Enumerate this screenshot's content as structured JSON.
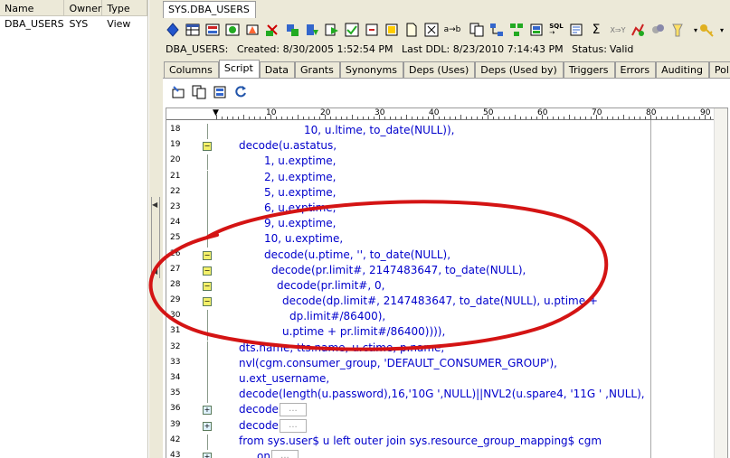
{
  "object_list": {
    "columns": [
      "Name",
      "Owner",
      "Type"
    ],
    "rows": [
      {
        "name": "DBA_USERS",
        "owner": "SYS",
        "type": "View"
      }
    ]
  },
  "document_tab": "SYS.DBA_USERS",
  "status": {
    "object": "DBA_USERS:",
    "created_label": "Created: 8/30/2005 1:52:54 PM",
    "last_ddl_label": "Last DDL: 8/23/2010 7:14:43 PM",
    "status_label": "Status:",
    "status_value": "Valid"
  },
  "tabs": [
    "Columns",
    "Script",
    "Data",
    "Grants",
    "Synonyms",
    "Deps (Uses)",
    "Deps (Used by)",
    "Triggers",
    "Errors",
    "Auditing",
    "Policies"
  ],
  "active_tab": "Script",
  "toolbar_icons": [
    "filter-icon",
    "table-icon",
    "index-icon",
    "constraint-icon",
    "trigger-icon",
    "delete-icon",
    "drop-icon",
    "user-icon",
    "grant-icon",
    "compile-icon",
    "export-icon",
    "import-icon",
    "doc-icon",
    "rename-icon",
    "search-replace-icon",
    "ab-icon",
    "copy-icon",
    "hierarchy-icon",
    "structure-icon",
    "tree-icon",
    "sql-icon",
    "sql-plan-icon",
    "sum-icon",
    "xy-icon",
    "chart-icon",
    "query-icon",
    "flashlight-icon",
    "key-icon",
    "dropdown-icon",
    "arrow-down-icon"
  ],
  "script_toolbar_icons": [
    "edit-script-icon",
    "copy-script-icon",
    "save-script-icon",
    "refresh-script-icon"
  ],
  "ruler": {
    "labels": [
      "10",
      "20",
      "30",
      "40",
      "50",
      "60",
      "70",
      "80",
      "90"
    ]
  },
  "code_lines": [
    {
      "num": "18",
      "fold": "",
      "text": "10, u.ltime, to_date(NULL)),"
    },
    {
      "num": "19",
      "fold": "-",
      "text": "decode(u.astatus,"
    },
    {
      "num": "20",
      "fold": "",
      "text": "1, u.exptime,"
    },
    {
      "num": "21",
      "fold": "",
      "text": "2, u.exptime,"
    },
    {
      "num": "22",
      "fold": "",
      "text": "5, u.exptime,"
    },
    {
      "num": "23",
      "fold": "",
      "text": "6, u.exptime,"
    },
    {
      "num": "24",
      "fold": "",
      "text": "9, u.exptime,"
    },
    {
      "num": "25",
      "fold": "",
      "text": "10, u.exptime,"
    },
    {
      "num": "26",
      "fold": "-",
      "text": "decode(u.ptime, '', to_date(NULL),"
    },
    {
      "num": "27",
      "fold": "-",
      "text": "decode(pr.limit#, 2147483647, to_date(NULL),"
    },
    {
      "num": "28",
      "fold": "-",
      "text": "decode(pr.limit#, 0,"
    },
    {
      "num": "29",
      "fold": "-",
      "text": "decode(dp.limit#, 2147483647, to_date(NULL), u.ptime +"
    },
    {
      "num": "30",
      "fold": "",
      "text": "dp.limit#/86400),"
    },
    {
      "num": "31",
      "fold": "",
      "text": "u.ptime + pr.limit#/86400)))),"
    },
    {
      "num": "32",
      "fold": "",
      "text": "dts.name, tts.name, u.ctime, p.name,"
    },
    {
      "num": "33",
      "fold": "",
      "text": "nvl(cgm.consumer_group, 'DEFAULT_CONSUMER_GROUP'),"
    },
    {
      "num": "34",
      "fold": "",
      "text": "u.ext_username,"
    },
    {
      "num": "35",
      "fold": "",
      "text": "decode(length(u.password),16,'10G ',NULL)||NVL2(u.spare4, '11G ' ,NULL),"
    },
    {
      "num": "36",
      "fold": "+",
      "text": "decode"
    },
    {
      "num": "39",
      "fold": "+",
      "text": "decode"
    },
    {
      "num": "42",
      "fold": "",
      "text": "from sys.user$ u left outer join sys.resource_group_mapping$ cgm"
    },
    {
      "num": "43",
      "fold": "+",
      "text": "on"
    }
  ],
  "collapsed_marker": "..."
}
